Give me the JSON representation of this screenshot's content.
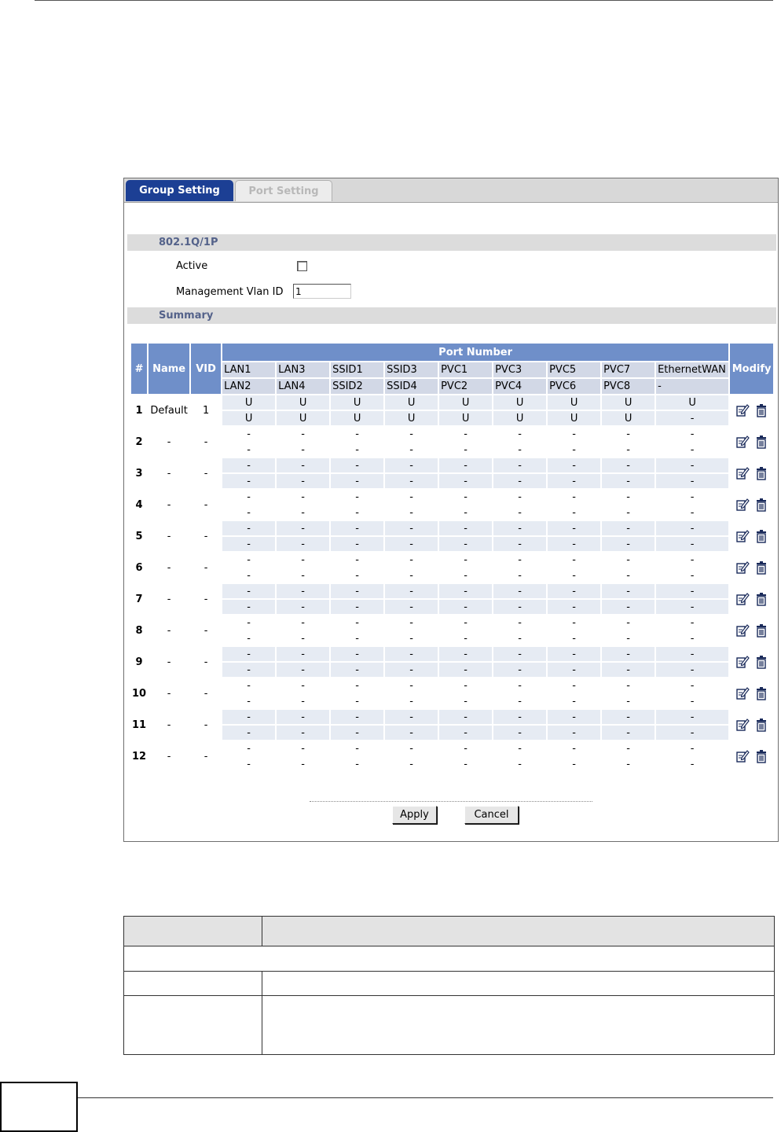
{
  "tabs": [
    {
      "label": "Group Setting",
      "active": true
    },
    {
      "label": "Port Setting",
      "active": false
    }
  ],
  "vlan_section": {
    "title": "802.1Q/1P",
    "active_label": "Active",
    "active_checked": false,
    "mgmt_label": "Management Vlan ID",
    "mgmt_value": "1"
  },
  "summary": {
    "title": "Summary",
    "headers": {
      "num": "#",
      "name": "Name",
      "vid": "VID",
      "port_number": "Port Number",
      "modify": "Modify"
    },
    "ports_top": [
      "LAN1",
      "LAN3",
      "SSID1",
      "SSID3",
      "PVC1",
      "PVC3",
      "PVC5",
      "PVC7",
      "EthernetWAN"
    ],
    "ports_bottom": [
      "LAN2",
      "LAN4",
      "SSID2",
      "SSID4",
      "PVC2",
      "PVC4",
      "PVC6",
      "PVC8",
      "-"
    ],
    "rows": [
      {
        "num": "1",
        "name": "Default",
        "vid": "1",
        "top": [
          "U",
          "U",
          "U",
          "U",
          "U",
          "U",
          "U",
          "U",
          "U"
        ],
        "bottom": [
          "U",
          "U",
          "U",
          "U",
          "U",
          "U",
          "U",
          "U",
          "-"
        ]
      },
      {
        "num": "2",
        "name": "-",
        "vid": "-",
        "top": [
          "-",
          "-",
          "-",
          "-",
          "-",
          "-",
          "-",
          "-",
          "-"
        ],
        "bottom": [
          "-",
          "-",
          "-",
          "-",
          "-",
          "-",
          "-",
          "-",
          "-"
        ]
      },
      {
        "num": "3",
        "name": "-",
        "vid": "-",
        "top": [
          "-",
          "-",
          "-",
          "-",
          "-",
          "-",
          "-",
          "-",
          "-"
        ],
        "bottom": [
          "-",
          "-",
          "-",
          "-",
          "-",
          "-",
          "-",
          "-",
          "-"
        ]
      },
      {
        "num": "4",
        "name": "-",
        "vid": "-",
        "top": [
          "-",
          "-",
          "-",
          "-",
          "-",
          "-",
          "-",
          "-",
          "-"
        ],
        "bottom": [
          "-",
          "-",
          "-",
          "-",
          "-",
          "-",
          "-",
          "-",
          "-"
        ]
      },
      {
        "num": "5",
        "name": "-",
        "vid": "-",
        "top": [
          "-",
          "-",
          "-",
          "-",
          "-",
          "-",
          "-",
          "-",
          "-"
        ],
        "bottom": [
          "-",
          "-",
          "-",
          "-",
          "-",
          "-",
          "-",
          "-",
          "-"
        ]
      },
      {
        "num": "6",
        "name": "-",
        "vid": "-",
        "top": [
          "-",
          "-",
          "-",
          "-",
          "-",
          "-",
          "-",
          "-",
          "-"
        ],
        "bottom": [
          "-",
          "-",
          "-",
          "-",
          "-",
          "-",
          "-",
          "-",
          "-"
        ]
      },
      {
        "num": "7",
        "name": "-",
        "vid": "-",
        "top": [
          "-",
          "-",
          "-",
          "-",
          "-",
          "-",
          "-",
          "-",
          "-"
        ],
        "bottom": [
          "-",
          "-",
          "-",
          "-",
          "-",
          "-",
          "-",
          "-",
          "-"
        ]
      },
      {
        "num": "8",
        "name": "-",
        "vid": "-",
        "top": [
          "-",
          "-",
          "-",
          "-",
          "-",
          "-",
          "-",
          "-",
          "-"
        ],
        "bottom": [
          "-",
          "-",
          "-",
          "-",
          "-",
          "-",
          "-",
          "-",
          "-"
        ]
      },
      {
        "num": "9",
        "name": "-",
        "vid": "-",
        "top": [
          "-",
          "-",
          "-",
          "-",
          "-",
          "-",
          "-",
          "-",
          "-"
        ],
        "bottom": [
          "-",
          "-",
          "-",
          "-",
          "-",
          "-",
          "-",
          "-",
          "-"
        ]
      },
      {
        "num": "10",
        "name": "-",
        "vid": "-",
        "top": [
          "-",
          "-",
          "-",
          "-",
          "-",
          "-",
          "-",
          "-",
          "-"
        ],
        "bottom": [
          "-",
          "-",
          "-",
          "-",
          "-",
          "-",
          "-",
          "-",
          "-"
        ]
      },
      {
        "num": "11",
        "name": "-",
        "vid": "-",
        "top": [
          "-",
          "-",
          "-",
          "-",
          "-",
          "-",
          "-",
          "-",
          "-"
        ],
        "bottom": [
          "-",
          "-",
          "-",
          "-",
          "-",
          "-",
          "-",
          "-",
          "-"
        ]
      },
      {
        "num": "12",
        "name": "-",
        "vid": "-",
        "top": [
          "-",
          "-",
          "-",
          "-",
          "-",
          "-",
          "-",
          "-",
          "-"
        ],
        "bottom": [
          "-",
          "-",
          "-",
          "-",
          "-",
          "-",
          "-",
          "-",
          "-"
        ]
      }
    ],
    "icons": {
      "edit": "edit-icon",
      "delete": "trash-icon"
    }
  },
  "buttons": {
    "apply": "Apply",
    "cancel": "Cancel"
  },
  "colors": {
    "tab_active": "#1c3f94",
    "header_blue": "#6f8fc9",
    "row_shade": "#e6ebf3",
    "section_text": "#54628a"
  }
}
